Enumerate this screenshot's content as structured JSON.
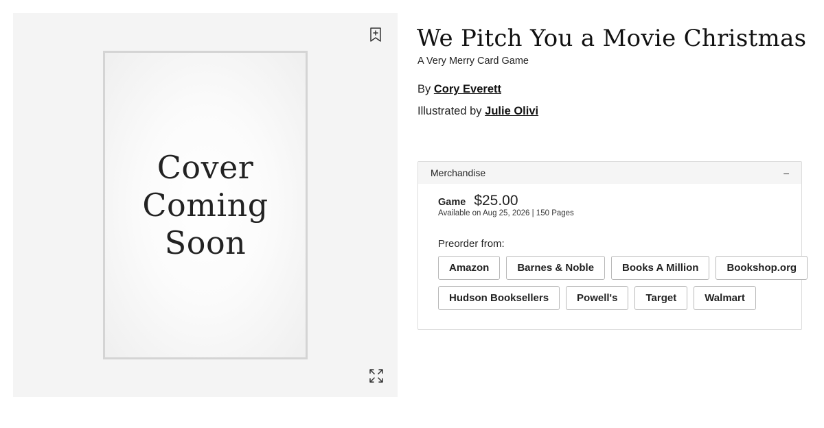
{
  "cover": {
    "placeholder_text": "Cover Coming Soon",
    "bookmark_icon": "bookmark-add-icon",
    "expand_icon": "expand-icon"
  },
  "product": {
    "title": "We Pitch You a Movie Christmas",
    "subtitle": "A Very Merry Card Game",
    "author_prefix": "By",
    "author": "Cory Everett",
    "illustrator_prefix": "Illustrated by",
    "illustrator": "Julie Olivi"
  },
  "merchandise": {
    "section_label": "Merchandise",
    "toggle": "–",
    "format": "Game",
    "price": "$25.00",
    "availability": "Available on Aug 25, 2026 | 150 Pages",
    "preorder_label": "Preorder from:",
    "retailers_row1": [
      "Amazon",
      "Barnes & Noble",
      "Books A Million",
      "Bookshop.org"
    ],
    "retailers_row2": [
      "Hudson Booksellers",
      "Powell's",
      "Target",
      "Walmart"
    ]
  }
}
